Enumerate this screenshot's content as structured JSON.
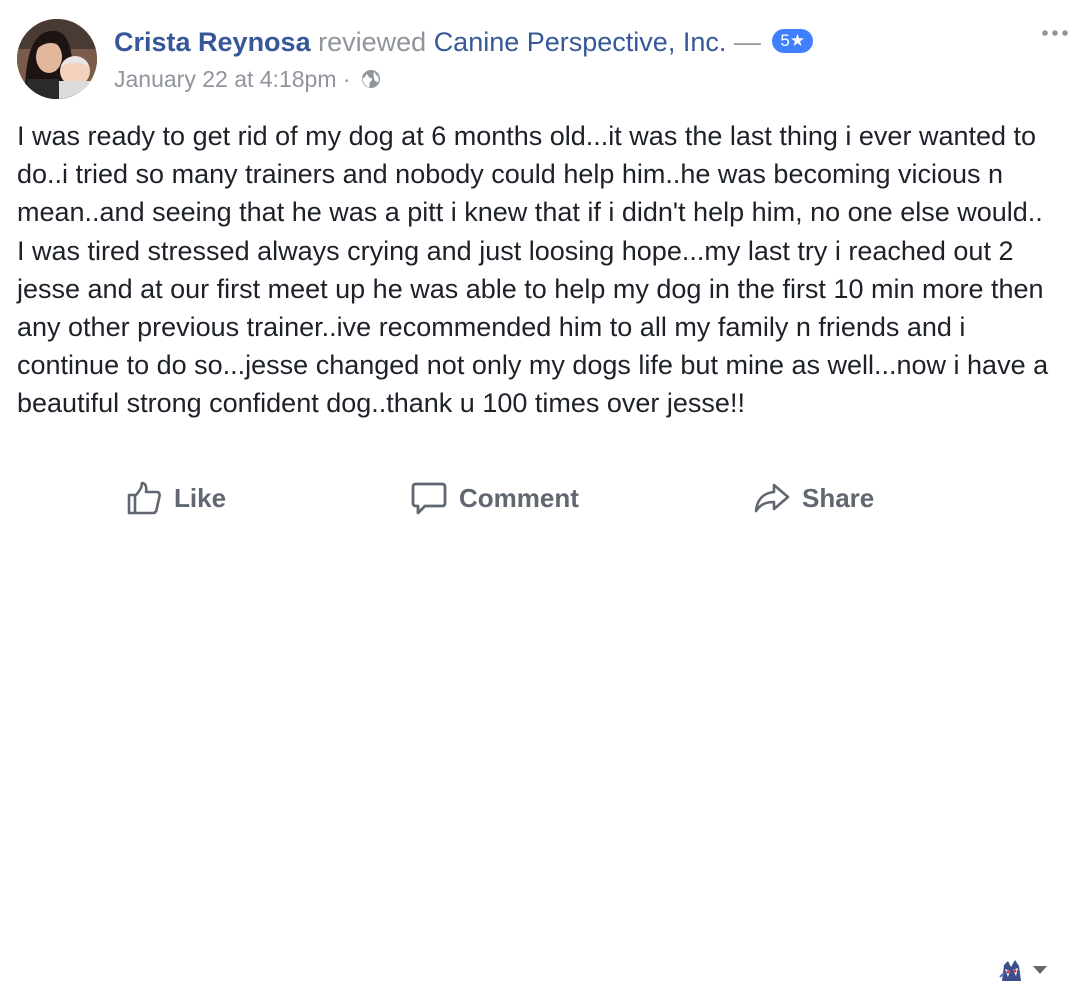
{
  "post": {
    "author": "Crista Reynosa",
    "verb": "reviewed",
    "page_name": "Canine Perspective, Inc.",
    "separator": "—",
    "rating": "5",
    "rating_icon": "star-icon",
    "timestamp": "January 22 at 4:18pm",
    "meta_separator": "·",
    "privacy_icon": "globe-icon",
    "text": "I was ready to get rid of my dog at 6 months old...it was the last thing i ever wanted to do..i tried so many trainers and nobody could help him..he was becoming vicious n mean..and seeing that he was a pitt i knew that if i didn't help him, no one else would.. I was tired stressed always crying and just loosing hope...my last try i reached out 2 jesse and at our first meet up he was able to help my dog in the first 10 min more then any other previous trainer..ive recommended him to all my family n friends and i continue to do so...jesse changed not only my dogs life but mine as well...now i have a beautiful strong confident dog..thank u 100 times over jesse!!"
  },
  "actions": {
    "like_label": "Like",
    "comment_label": "Comment",
    "share_label": "Share",
    "like_icon": "thumbs-up-icon",
    "comment_icon": "comment-bubble-icon",
    "share_icon": "share-arrow-icon"
  },
  "colors": {
    "link_blue": "#365899",
    "muted_gray": "#90949c",
    "action_gray": "#606770",
    "badge_blue": "#4080ff",
    "text_dark": "#1d2129"
  }
}
